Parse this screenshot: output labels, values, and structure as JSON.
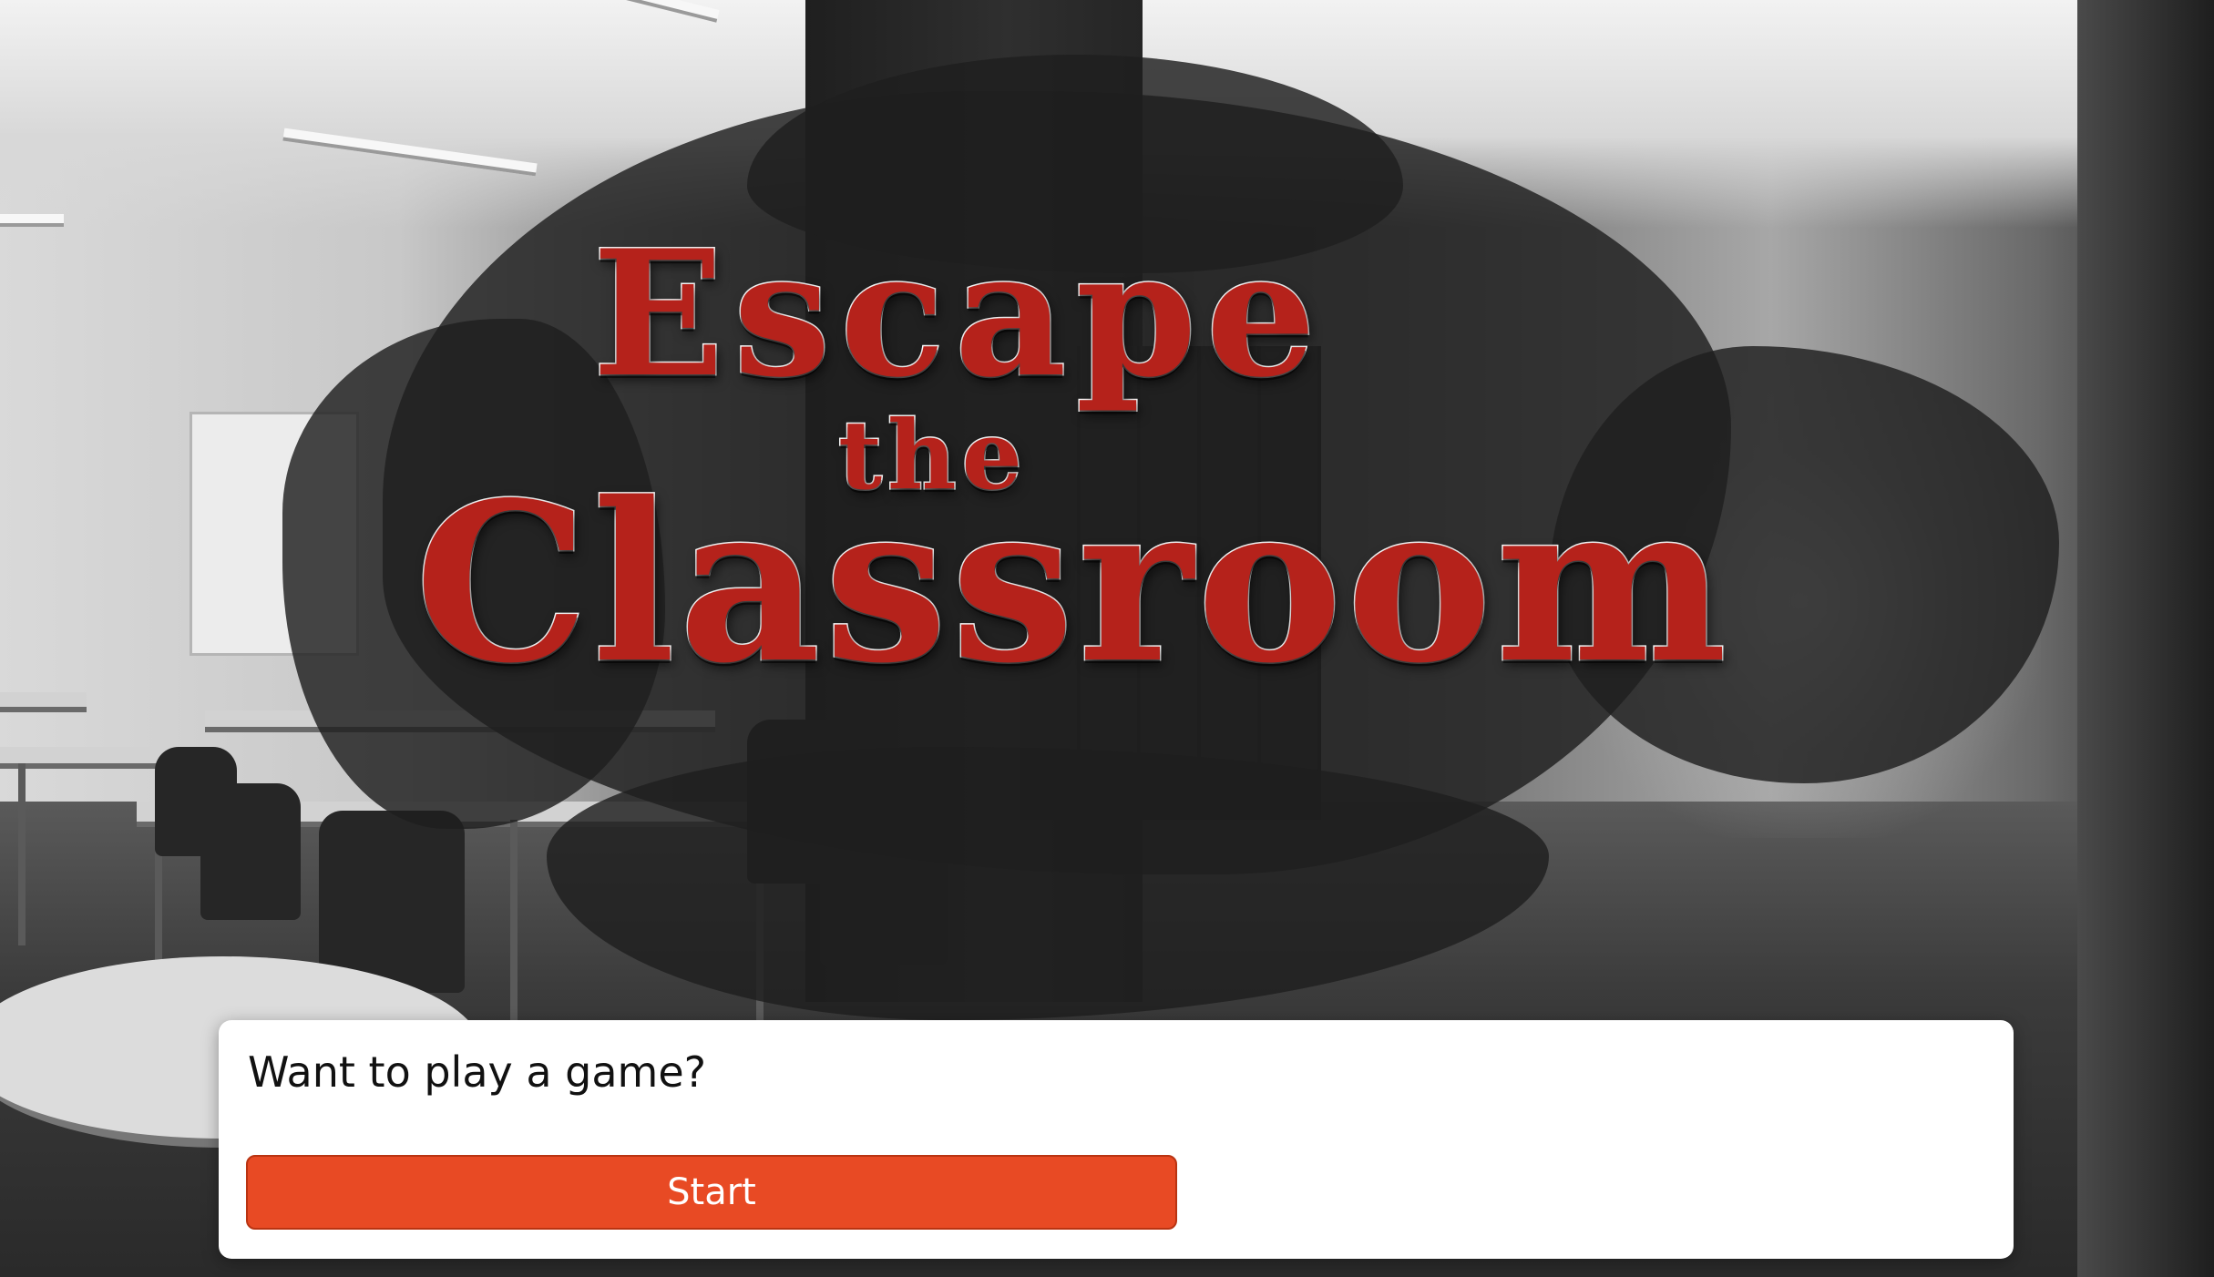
{
  "title": {
    "line1": "Escape",
    "line2": "the",
    "line3": "Classroom"
  },
  "dialog": {
    "prompt": "Want to play a game?",
    "start_label": "Start"
  },
  "colors": {
    "title_red": "#b5221b",
    "button_orange": "#e84a24",
    "panel_white": "#ffffff"
  }
}
